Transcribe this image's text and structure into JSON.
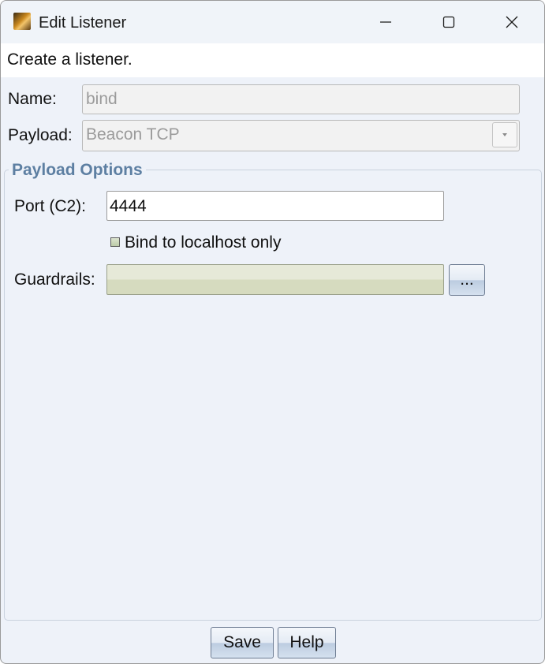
{
  "window": {
    "title": "Edit Listener",
    "icon": "cobalt-strike-app-icon"
  },
  "banner": {
    "text": "Create a listener."
  },
  "form": {
    "name_label": "Name:",
    "name_value": "bind",
    "payload_label": "Payload:",
    "payload_value": "Beacon TCP"
  },
  "payload_options": {
    "title": "Payload Options",
    "port_label": "Port (C2):",
    "port_value": "4444",
    "bind_label": "Bind to localhost only",
    "bind_checked": false,
    "guardrails_label": "Guardrails:",
    "guardrails_value": "",
    "browse_label": "..."
  },
  "buttons": {
    "save": "Save",
    "help": "Help"
  }
}
